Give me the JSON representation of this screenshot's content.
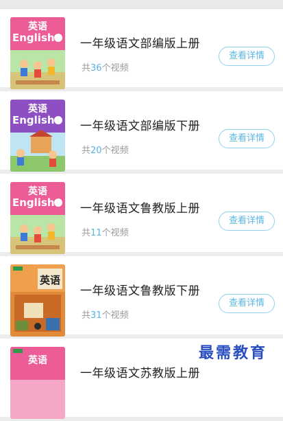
{
  "list": {
    "items": [
      {
        "title": "一年级语文部编版上册",
        "count_prefix": "共",
        "count": "36",
        "count_suffix": "个视频",
        "button": "查看详情",
        "cover_subject": "英语",
        "cover_english": "English",
        "cover_style": "pink"
      },
      {
        "title": "一年级语文部编版下册",
        "count_prefix": "共",
        "count": "20",
        "count_suffix": "个视频",
        "button": "查看详情",
        "cover_subject": "英语",
        "cover_english": "English",
        "cover_style": "purple"
      },
      {
        "title": "一年级语文鲁教版上册",
        "count_prefix": "共",
        "count": "11",
        "count_suffix": "个视频",
        "button": "查看详情",
        "cover_subject": "英语",
        "cover_english": "English",
        "cover_style": "pink"
      },
      {
        "title": "一年级语文鲁教版下册",
        "count_prefix": "共",
        "count": "31",
        "count_suffix": "个视频",
        "button": "查看详情",
        "cover_subject": "英语",
        "cover_english": "",
        "cover_style": "orange"
      },
      {
        "title": "一年级语文苏教版上册",
        "count_prefix": "",
        "count": "",
        "count_suffix": "",
        "button": "",
        "cover_subject": "英语",
        "cover_english": "",
        "cover_style": "pink-small"
      }
    ]
  },
  "watermark": "最需教育",
  "colors": {
    "accent": "#56b3e3",
    "button_border": "#8fd0ef",
    "title": "#222222",
    "muted": "#999999",
    "watermark": "#2a4ec2"
  }
}
